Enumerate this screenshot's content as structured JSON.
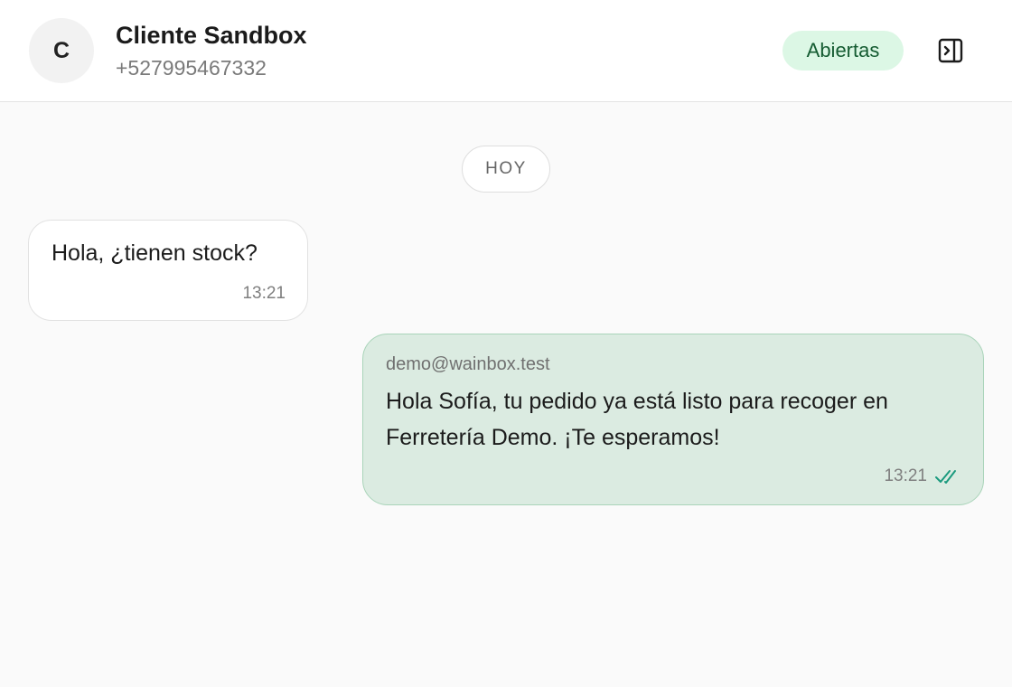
{
  "header": {
    "avatar_initial": "C",
    "contact_name": "Cliente Sandbox",
    "contact_phone": "+527995467332",
    "status_label": "Abiertas",
    "panel_toggle_icon": "sidebar-toggle-icon"
  },
  "conversation": {
    "date_separator": "HOY",
    "messages": [
      {
        "direction": "incoming",
        "text": "Hola, ¿tienen stock?",
        "time": "13:21"
      },
      {
        "direction": "outgoing",
        "sender": "demo@wainbox.test",
        "text": "Hola Sofía, tu pedido ya está listo para recoger en Ferretería Demo. ¡Te esperamos!",
        "time": "13:21",
        "status_icon": "double-check-icon"
      }
    ]
  },
  "colors": {
    "badge_bg": "#dcf7e5",
    "outgoing_bubble_bg": "#dbebe1",
    "outgoing_bubble_border": "#a9d4b9",
    "read_check": "#1a9a7e"
  }
}
